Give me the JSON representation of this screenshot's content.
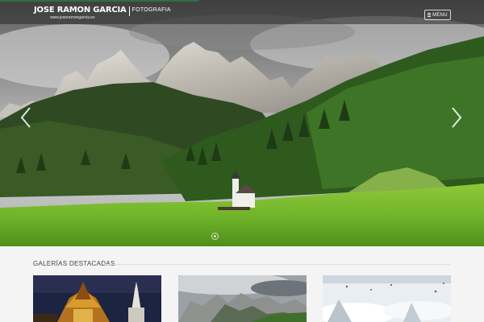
{
  "brand": {
    "name": "JOSE RAMON GARCIA",
    "tagline": "FOTOGRAFIA",
    "url": "www.joseramongarcia.es"
  },
  "menu": {
    "label": "MENU",
    "icon": "hamburger-icon"
  },
  "slider": {
    "progress": 0.41,
    "prev_icon": "chevron-left-icon",
    "next_icon": "chevron-right-icon",
    "dot_icon": "slide-indicator-icon"
  },
  "gallery": {
    "title": "GALERÍAS DESTACADAS",
    "items": [
      {
        "subject": "temple"
      },
      {
        "subject": "mountains"
      },
      {
        "subject": "snow"
      }
    ]
  },
  "colors": {
    "accent": "#3fbf5f",
    "topbar": "#282828",
    "background": "#f4f4f4"
  }
}
